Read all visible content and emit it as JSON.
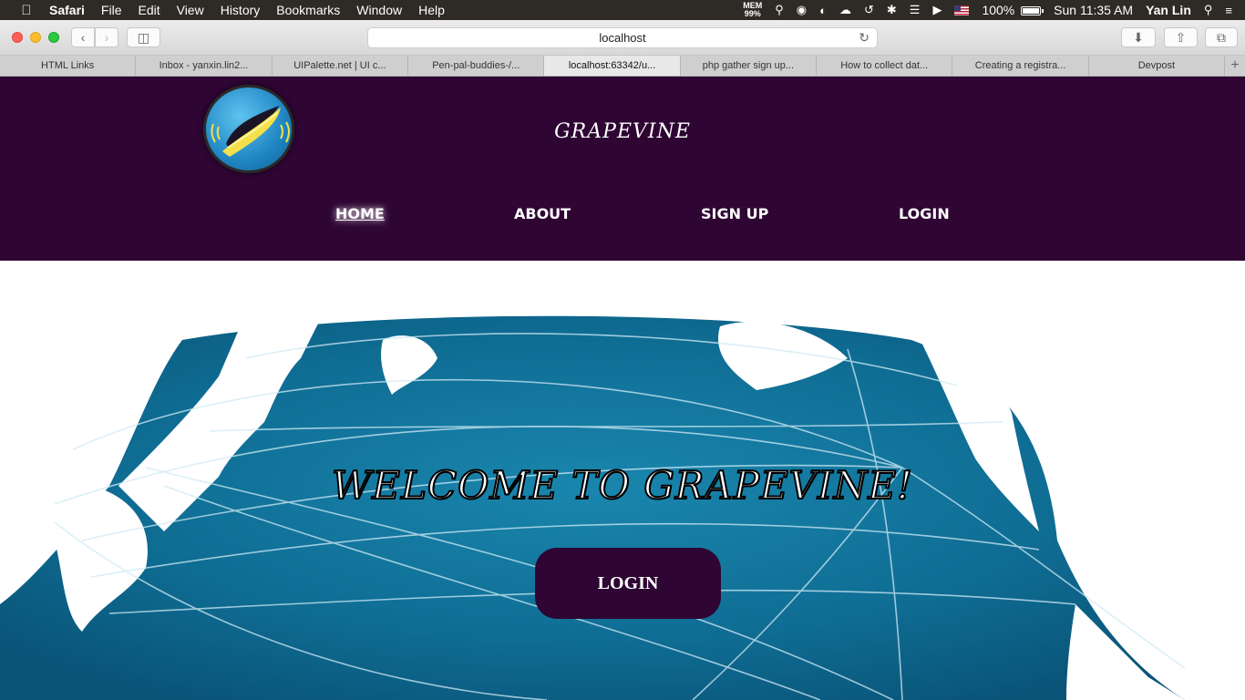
{
  "menubar": {
    "items": [
      "Safari",
      "File",
      "Edit",
      "View",
      "History",
      "Bookmarks",
      "Window",
      "Help"
    ],
    "mem_label": "MEM",
    "mem_value": "99%",
    "battery": "100%",
    "clock": "Sun 11:35 AM",
    "user": "Yan Lin"
  },
  "browser": {
    "url": "localhost",
    "tabs": [
      "HTML Links",
      "Inbox - yanxin.lin2...",
      "UIPalette.net | UI c...",
      "Pen-pal-buddies-/...",
      "localhost:63342/u...",
      "php gather sign up...",
      "How to collect dat...",
      "Creating a registra...",
      "Devpost"
    ],
    "active_tab": 4
  },
  "site": {
    "title": "GRAPEVINE",
    "nav": [
      "HOME",
      "ABOUT",
      "SIGN UP",
      "LOGIN"
    ],
    "active_nav": 0,
    "hero_title": "WELCOME TO GRAPEVINE!",
    "hero_button": "LOGIN"
  },
  "colors": {
    "header_bg": "#2e0533",
    "button_bg": "#2e0533",
    "ocean": "#0f6d94",
    "land": "#ffffff"
  }
}
